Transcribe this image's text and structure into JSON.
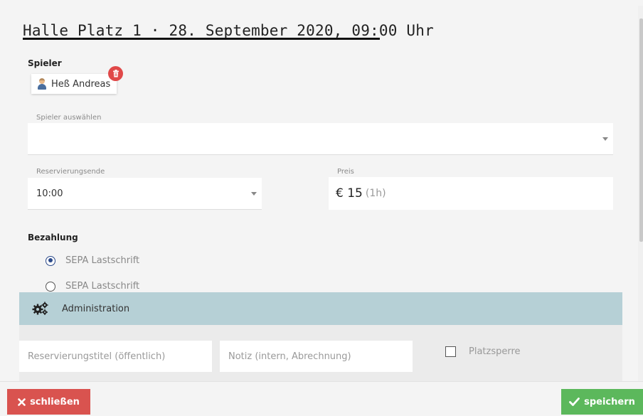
{
  "modal": {
    "title": "Halle Platz 1 · 28. September 2020, 09:00 Uhr"
  },
  "players": {
    "label": "Spieler",
    "selected": [
      {
        "name": "Heß Andreas"
      }
    ],
    "select_label": "Spieler auswählen",
    "select_value": ""
  },
  "reservation_end": {
    "label": "Reservierungsende",
    "value": "10:00"
  },
  "price": {
    "label": "Preis",
    "value": "€ 15",
    "duration": "(1h)"
  },
  "payment": {
    "label": "Bezahlung",
    "options": [
      {
        "label": "SEPA Lastschrift",
        "checked": true
      },
      {
        "label": "SEPA Lastschrift",
        "checked": false
      }
    ]
  },
  "admin": {
    "label": "Administration",
    "title_placeholder": "Reservierungstitel (öffentlich)",
    "note_placeholder": "Notiz (intern, Abrechnung)",
    "lock_label": "Platzsperre",
    "lock_checked": false
  },
  "footer": {
    "close_label": "schließen",
    "save_label": "speichern"
  },
  "colors": {
    "close_button": "#d9534f",
    "save_button": "#5cb85c",
    "admin_bar": "#b6d0d6",
    "radio_accent": "#2c4a8a",
    "delete_badge": "#e04848"
  }
}
